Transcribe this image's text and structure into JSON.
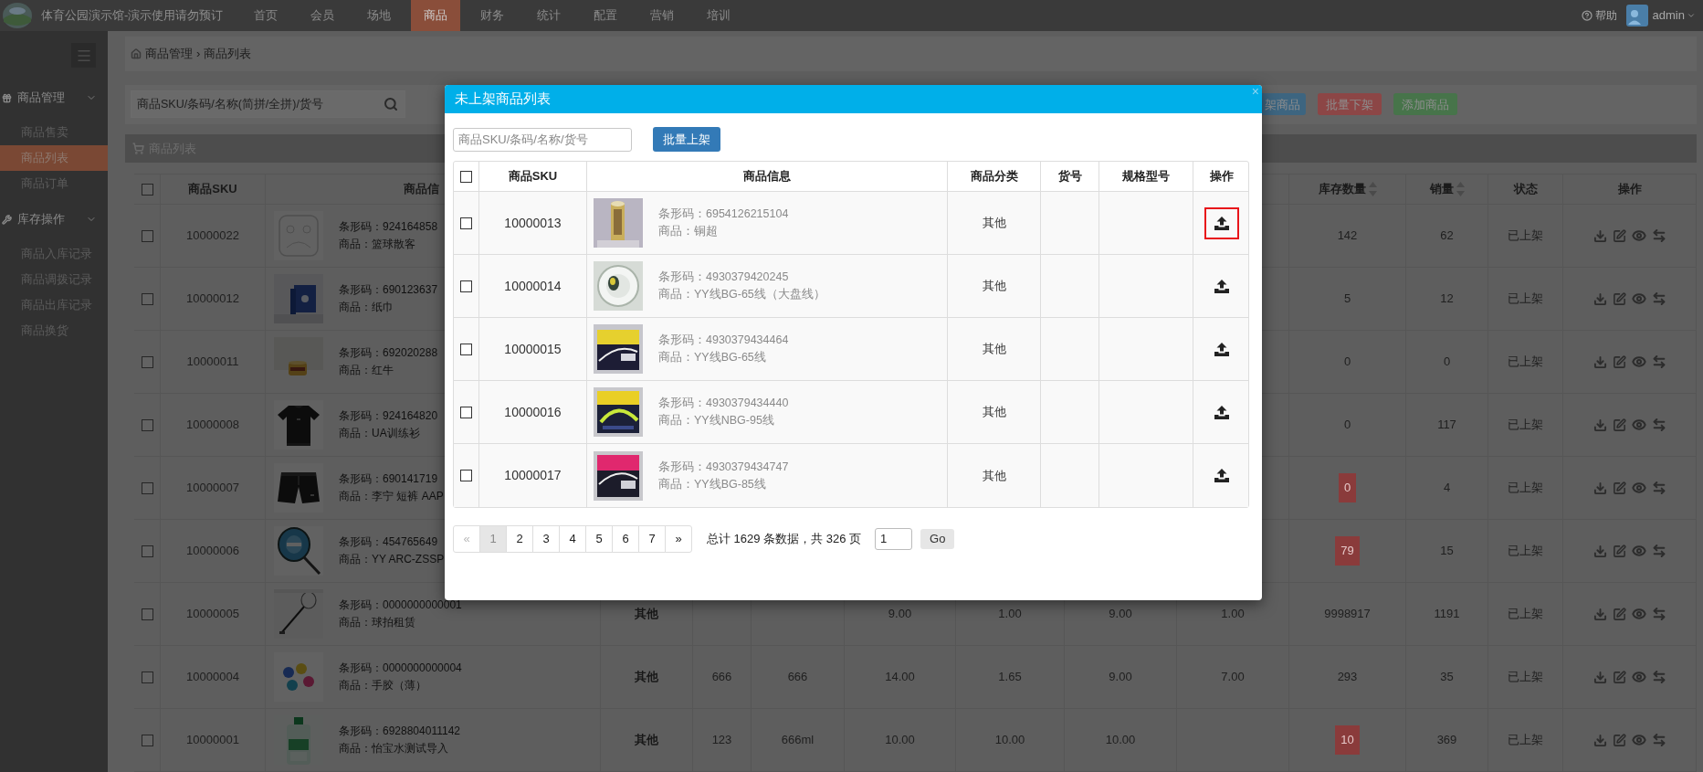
{
  "top_bar": {
    "title": "体育公园演示馆-演示使用请勿预订",
    "nav": [
      {
        "label": "首页",
        "selected": false
      },
      {
        "label": "会员",
        "selected": false
      },
      {
        "label": "场地",
        "selected": false
      },
      {
        "label": "商品",
        "selected": true
      },
      {
        "label": "财务",
        "selected": false
      },
      {
        "label": "统计",
        "selected": false
      },
      {
        "label": "配置",
        "selected": false
      },
      {
        "label": "营销",
        "selected": false
      },
      {
        "label": "培训",
        "selected": false
      }
    ],
    "help": "帮助",
    "user": "admin"
  },
  "sidebar": {
    "groups": [
      {
        "label": "商品管理",
        "items": [
          {
            "label": "商品售卖",
            "selected": false
          },
          {
            "label": "商品列表",
            "selected": true
          },
          {
            "label": "商品订单",
            "selected": false
          }
        ]
      },
      {
        "label": "库存操作",
        "items": [
          {
            "label": "商品入库记录",
            "selected": false
          },
          {
            "label": "商品调拨记录",
            "selected": false
          },
          {
            "label": "商品出库记录",
            "selected": false
          },
          {
            "label": "商品换货",
            "selected": false
          }
        ]
      }
    ]
  },
  "breadcrumb": {
    "items": [
      "商品管理",
      "商品列表"
    ],
    "separator": "›"
  },
  "search": {
    "placeholder": "商品SKU/条码/名称(简拼/全拼)/货号"
  },
  "actions": [
    {
      "label": "架商品",
      "color": "#3d6580"
    },
    {
      "label": "批量下架",
      "color": "#8c4646"
    },
    {
      "label": "添加商品",
      "color": "#47744a"
    }
  ],
  "panel_title": "商品列表",
  "table": {
    "header_checked": false,
    "columns": [
      {
        "label": "商品SKU",
        "sortable": false
      },
      {
        "label": "商品信",
        "sortable": false
      },
      {
        "label": "库存数量",
        "sortable": true
      },
      {
        "label": "销量",
        "sortable": true
      },
      {
        "label": "状态",
        "sortable": false
      },
      {
        "label": "操作",
        "sortable": false
      }
    ],
    "rows": [
      {
        "checked": false,
        "sku": "10000022",
        "barcode": "条形码：924164858",
        "name": "商品：篮球散客",
        "stock": "142",
        "stock_low": false,
        "sales": "62",
        "status": "已上架"
      },
      {
        "checked": false,
        "sku": "10000012",
        "barcode": "条形码：690123637",
        "name": "商品：纸巾",
        "stock": "5",
        "stock_low": false,
        "sales": "12",
        "status": "已上架"
      },
      {
        "checked": false,
        "sku": "10000011",
        "barcode": "条形码：692020288",
        "name": "商品：红牛",
        "stock": "0",
        "stock_low": false,
        "sales": "0",
        "status": "已上架"
      },
      {
        "checked": false,
        "sku": "10000008",
        "barcode": "条形码：924164820",
        "name": "商品：UA训练衫",
        "stock": "0",
        "stock_low": false,
        "sales": "117",
        "status": "已上架"
      },
      {
        "checked": false,
        "sku": "10000007",
        "barcode": "条形码：690141719",
        "name": "商品：李宁 短裤 AAP",
        "stock": "0",
        "stock_low": true,
        "sales": "4",
        "status": "已上架"
      },
      {
        "checked": false,
        "sku": "10000006",
        "barcode": "条形码：454765649",
        "name": "商品：YY ARC-ZSSP",
        "stock": "79",
        "stock_low": true,
        "sales": "15",
        "status": "已上架"
      },
      {
        "checked": false,
        "sku": "10000005",
        "barcode": "条形码：0000000000001",
        "name": "商品：球拍租赁",
        "cells": {
          "column_4": "其他",
          "column_7": "9.00",
          "column_8": "1.00",
          "column_9": "9.00",
          "column_10": "1.00"
        },
        "stock": "9998917",
        "stock_low": false,
        "sales": "1191",
        "status": "已上架"
      },
      {
        "checked": false,
        "sku": "10000004",
        "barcode": "条形码：0000000000004",
        "name": "商品：手胶（薄）",
        "cells": {
          "column_4": "其他",
          "column_5": "666",
          "column_6": "666",
          "column_7": "14.00",
          "column_8": "1.65",
          "column_9": "9.00",
          "column_10": "7.00"
        },
        "stock": "293",
        "stock_low": false,
        "sales": "35",
        "status": "已上架"
      },
      {
        "checked": false,
        "sku": "10000001",
        "barcode": "条形码：6928804011142",
        "name": "商品：怡宝水测试导入",
        "cells": {
          "column_4": "其他",
          "column_5": "123",
          "column_6": "666ml",
          "column_7": "10.00",
          "column_8": "10.00",
          "column_9": "10.00"
        },
        "stock": "10",
        "stock_low": true,
        "sales": "369",
        "status": "已上架"
      }
    ]
  },
  "modal": {
    "title": "未上架商品列表",
    "close": "×",
    "search": {
      "placeholder": "商品SKU/条码/名称/货号"
    },
    "batch_button": "批量上架",
    "header_checked": false,
    "columns": [
      "商品SKU",
      "商品信息",
      "商品分类",
      "货号",
      "规格型号",
      "操作"
    ],
    "rows": [
      {
        "checked": false,
        "sku": "10000013",
        "barcode": "条形码：6954126215104",
        "name": "商品：铜超",
        "category": "其他",
        "highlighted": true
      },
      {
        "checked": false,
        "sku": "10000014",
        "barcode": "条形码：4930379420245",
        "name": "商品：YY线BG-65线（大盘线）",
        "category": "其他",
        "highlighted": false
      },
      {
        "checked": false,
        "sku": "10000015",
        "barcode": "条形码：4930379434464",
        "name": "商品：YY线BG-65线",
        "category": "其他",
        "highlighted": false
      },
      {
        "checked": false,
        "sku": "10000016",
        "barcode": "条形码：4930379434440",
        "name": "商品：YY线NBG-95线",
        "category": "其他",
        "highlighted": false
      },
      {
        "checked": false,
        "sku": "10000017",
        "barcode": "条形码：4930379434747",
        "name": "商品：YY线BG-85线",
        "category": "其他",
        "highlighted": false
      }
    ],
    "pagination": {
      "pages": [
        {
          "label": "«",
          "disabled": true,
          "selected": false
        },
        {
          "label": "1",
          "disabled": false,
          "selected": true
        },
        {
          "label": "2",
          "disabled": false,
          "selected": false
        },
        {
          "label": "3",
          "disabled": false,
          "selected": false
        },
        {
          "label": "4",
          "disabled": false,
          "selected": false
        },
        {
          "label": "5",
          "disabled": false,
          "selected": false
        },
        {
          "label": "6",
          "disabled": false,
          "selected": false
        },
        {
          "label": "7",
          "disabled": false,
          "selected": false
        },
        {
          "label": "»",
          "disabled": false,
          "selected": false
        }
      ],
      "summary": "总计 1629 条数据，共 326 页",
      "page_input": "1",
      "go": "Go"
    }
  }
}
